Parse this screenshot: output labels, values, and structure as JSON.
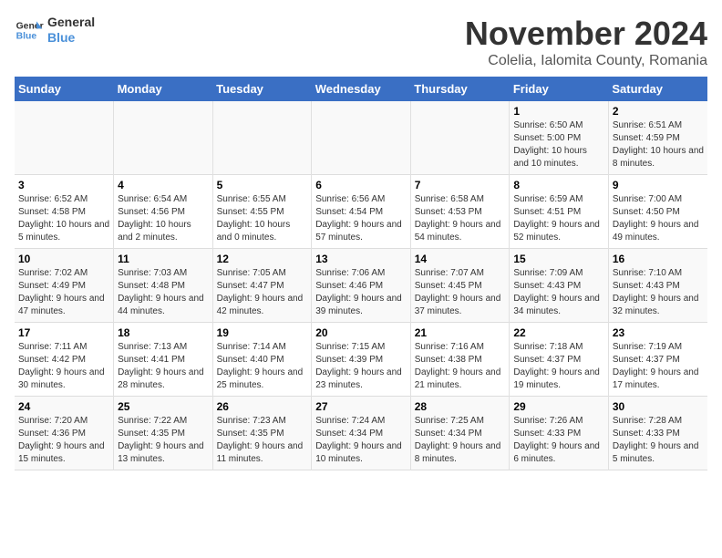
{
  "logo": {
    "text_general": "General",
    "text_blue": "Blue"
  },
  "header": {
    "month_title": "November 2024",
    "subtitle": "Colelia, Ialomita County, Romania"
  },
  "weekdays": [
    "Sunday",
    "Monday",
    "Tuesday",
    "Wednesday",
    "Thursday",
    "Friday",
    "Saturday"
  ],
  "weeks": [
    [
      {
        "day": "",
        "info": ""
      },
      {
        "day": "",
        "info": ""
      },
      {
        "day": "",
        "info": ""
      },
      {
        "day": "",
        "info": ""
      },
      {
        "day": "",
        "info": ""
      },
      {
        "day": "1",
        "info": "Sunrise: 6:50 AM\nSunset: 5:00 PM\nDaylight: 10 hours and 10 minutes."
      },
      {
        "day": "2",
        "info": "Sunrise: 6:51 AM\nSunset: 4:59 PM\nDaylight: 10 hours and 8 minutes."
      }
    ],
    [
      {
        "day": "3",
        "info": "Sunrise: 6:52 AM\nSunset: 4:58 PM\nDaylight: 10 hours and 5 minutes."
      },
      {
        "day": "4",
        "info": "Sunrise: 6:54 AM\nSunset: 4:56 PM\nDaylight: 10 hours and 2 minutes."
      },
      {
        "day": "5",
        "info": "Sunrise: 6:55 AM\nSunset: 4:55 PM\nDaylight: 10 hours and 0 minutes."
      },
      {
        "day": "6",
        "info": "Sunrise: 6:56 AM\nSunset: 4:54 PM\nDaylight: 9 hours and 57 minutes."
      },
      {
        "day": "7",
        "info": "Sunrise: 6:58 AM\nSunset: 4:53 PM\nDaylight: 9 hours and 54 minutes."
      },
      {
        "day": "8",
        "info": "Sunrise: 6:59 AM\nSunset: 4:51 PM\nDaylight: 9 hours and 52 minutes."
      },
      {
        "day": "9",
        "info": "Sunrise: 7:00 AM\nSunset: 4:50 PM\nDaylight: 9 hours and 49 minutes."
      }
    ],
    [
      {
        "day": "10",
        "info": "Sunrise: 7:02 AM\nSunset: 4:49 PM\nDaylight: 9 hours and 47 minutes."
      },
      {
        "day": "11",
        "info": "Sunrise: 7:03 AM\nSunset: 4:48 PM\nDaylight: 9 hours and 44 minutes."
      },
      {
        "day": "12",
        "info": "Sunrise: 7:05 AM\nSunset: 4:47 PM\nDaylight: 9 hours and 42 minutes."
      },
      {
        "day": "13",
        "info": "Sunrise: 7:06 AM\nSunset: 4:46 PM\nDaylight: 9 hours and 39 minutes."
      },
      {
        "day": "14",
        "info": "Sunrise: 7:07 AM\nSunset: 4:45 PM\nDaylight: 9 hours and 37 minutes."
      },
      {
        "day": "15",
        "info": "Sunrise: 7:09 AM\nSunset: 4:43 PM\nDaylight: 9 hours and 34 minutes."
      },
      {
        "day": "16",
        "info": "Sunrise: 7:10 AM\nSunset: 4:43 PM\nDaylight: 9 hours and 32 minutes."
      }
    ],
    [
      {
        "day": "17",
        "info": "Sunrise: 7:11 AM\nSunset: 4:42 PM\nDaylight: 9 hours and 30 minutes."
      },
      {
        "day": "18",
        "info": "Sunrise: 7:13 AM\nSunset: 4:41 PM\nDaylight: 9 hours and 28 minutes."
      },
      {
        "day": "19",
        "info": "Sunrise: 7:14 AM\nSunset: 4:40 PM\nDaylight: 9 hours and 25 minutes."
      },
      {
        "day": "20",
        "info": "Sunrise: 7:15 AM\nSunset: 4:39 PM\nDaylight: 9 hours and 23 minutes."
      },
      {
        "day": "21",
        "info": "Sunrise: 7:16 AM\nSunset: 4:38 PM\nDaylight: 9 hours and 21 minutes."
      },
      {
        "day": "22",
        "info": "Sunrise: 7:18 AM\nSunset: 4:37 PM\nDaylight: 9 hours and 19 minutes."
      },
      {
        "day": "23",
        "info": "Sunrise: 7:19 AM\nSunset: 4:37 PM\nDaylight: 9 hours and 17 minutes."
      }
    ],
    [
      {
        "day": "24",
        "info": "Sunrise: 7:20 AM\nSunset: 4:36 PM\nDaylight: 9 hours and 15 minutes."
      },
      {
        "day": "25",
        "info": "Sunrise: 7:22 AM\nSunset: 4:35 PM\nDaylight: 9 hours and 13 minutes."
      },
      {
        "day": "26",
        "info": "Sunrise: 7:23 AM\nSunset: 4:35 PM\nDaylight: 9 hours and 11 minutes."
      },
      {
        "day": "27",
        "info": "Sunrise: 7:24 AM\nSunset: 4:34 PM\nDaylight: 9 hours and 10 minutes."
      },
      {
        "day": "28",
        "info": "Sunrise: 7:25 AM\nSunset: 4:34 PM\nDaylight: 9 hours and 8 minutes."
      },
      {
        "day": "29",
        "info": "Sunrise: 7:26 AM\nSunset: 4:33 PM\nDaylight: 9 hours and 6 minutes."
      },
      {
        "day": "30",
        "info": "Sunrise: 7:28 AM\nSunset: 4:33 PM\nDaylight: 9 hours and 5 minutes."
      }
    ]
  ]
}
